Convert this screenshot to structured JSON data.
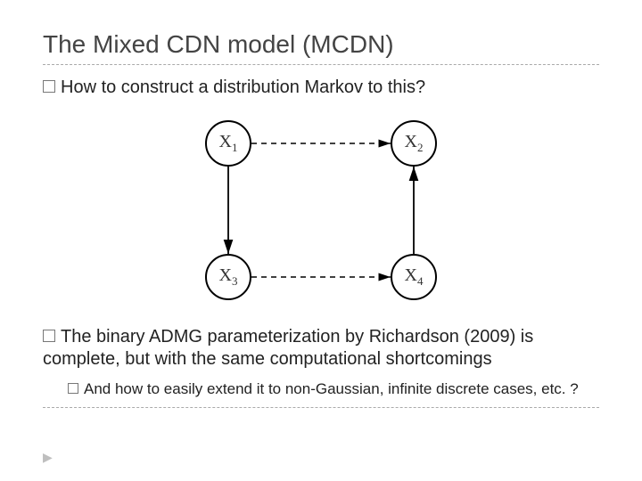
{
  "title": "The Mixed CDN model (MCDN)",
  "bullets": {
    "b1": "How to construct a distribution Markov to this?",
    "b2": "The binary ADMG parameterization by Richardson (2009) is complete, but with the same computational shortcomings",
    "b2sub": "And how to easily extend it to non-Gaussian, infinite discrete cases, etc. ?"
  },
  "nodes": {
    "x1": {
      "label": "X",
      "sub": "1"
    },
    "x2": {
      "label": "X",
      "sub": "2"
    },
    "x3": {
      "label": "X",
      "sub": "3"
    },
    "x4": {
      "label": "X",
      "sub": "4"
    }
  },
  "chart_data": {
    "type": "diagram",
    "nodes": [
      "X1",
      "X2",
      "X3",
      "X4"
    ],
    "directed_edges": [
      {
        "from": "X1",
        "to": "X3"
      },
      {
        "from": "X4",
        "to": "X2"
      }
    ],
    "bidirected_edges": [
      {
        "a": "X1",
        "b": "X2",
        "style": "dashed"
      },
      {
        "a": "X3",
        "b": "X4",
        "style": "dashed"
      }
    ]
  }
}
